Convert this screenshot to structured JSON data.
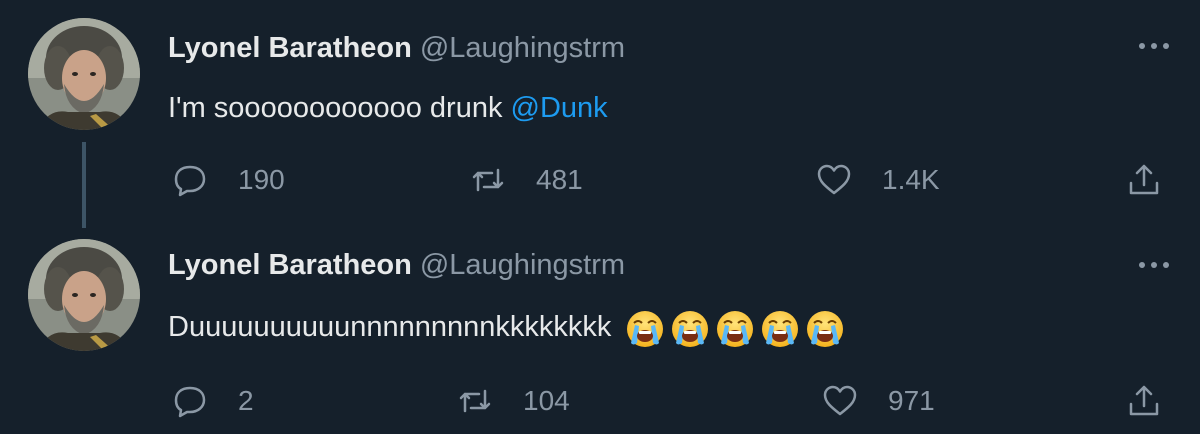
{
  "tweets": [
    {
      "author": {
        "name": "Lyonel Baratheon",
        "handle": "@Laughingstrm"
      },
      "text": "I'm soooooooooooo drunk ",
      "mention": "@Dunk",
      "emoji_count": 0,
      "stats": {
        "replies": "190",
        "retweets": "481",
        "likes": "1.4K"
      },
      "has_thread_line": true
    },
    {
      "author": {
        "name": "Lyonel Baratheon",
        "handle": "@Laughingstrm"
      },
      "text": "Duuuuuuuuuunnnnnnnnnkkkkkkkk",
      "mention": "",
      "emojis": [
        "loudly-crying-face",
        "loudly-crying-face",
        "loudly-crying-face",
        "loudly-crying-face",
        "loudly-crying-face"
      ],
      "stats": {
        "replies": "2",
        "retweets": "104",
        "likes": "971"
      },
      "has_thread_line": false
    }
  ],
  "theme": {
    "background": "#15202b",
    "text": "#e7e9ea",
    "secondary": "#8b98a5",
    "link": "#1d9bf0",
    "thread_line": "#3d5466"
  }
}
